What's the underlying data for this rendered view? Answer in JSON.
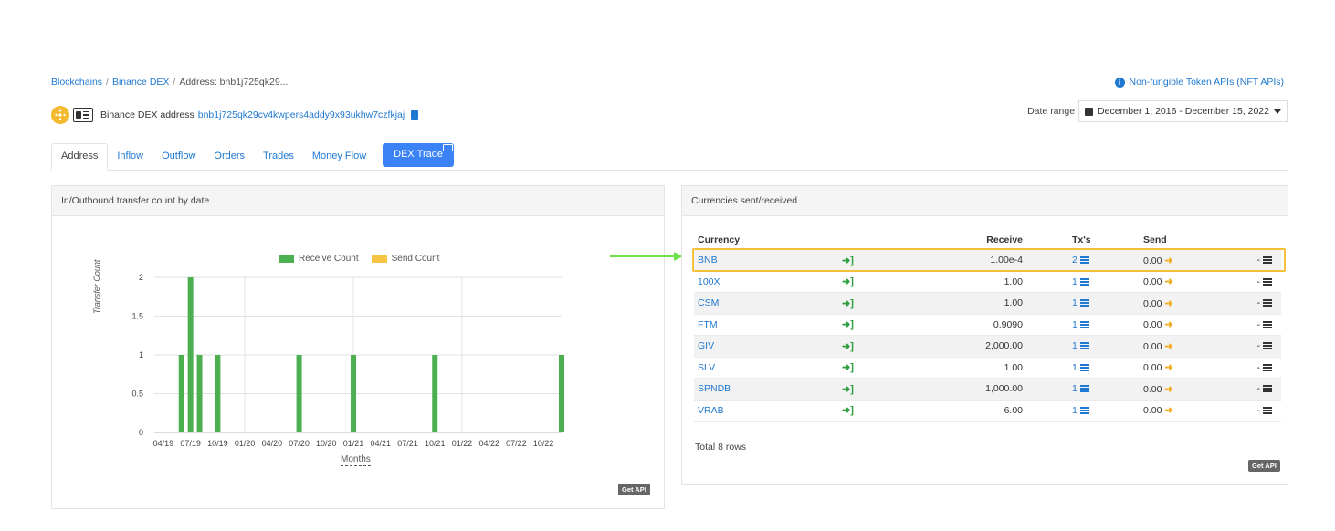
{
  "breadcrumb": {
    "item1": "Blockchains",
    "item2": "Binance DEX",
    "item3": "Address: bnb1j725qk29..."
  },
  "nft_link": "Non-fungible Token APIs (NFT APIs)",
  "address_label": "Binance DEX address",
  "address_value": "bnb1j725qk29cv4kwpers4addy9x93ukhw7czfkjaj",
  "date_range_label": "Date range",
  "date_range_value": "December 1, 2016 - December 15, 2022",
  "tabs": [
    "Address",
    "Inflow",
    "Outflow",
    "Orders",
    "Trades",
    "Money Flow",
    "DEX Trade"
  ],
  "left_panel": {
    "title": "In/Outbound transfer count by date",
    "get_api": "Get API"
  },
  "right_panel": {
    "title": "Currencies sent/received",
    "get_api": "Get API",
    "total_rows": "Total 8 rows",
    "columns": [
      "Currency",
      "",
      "Receive",
      "Tx's",
      "Send",
      ""
    ],
    "rows": [
      {
        "currency": "BNB",
        "receive": "1.00e-4",
        "txs": "2",
        "send": "0.00",
        "tail": "-"
      },
      {
        "currency": "100X",
        "receive": "1.00",
        "txs": "1",
        "send": "0.00",
        "tail": "-"
      },
      {
        "currency": "CSM",
        "receive": "1.00",
        "txs": "1",
        "send": "0.00",
        "tail": "-"
      },
      {
        "currency": "FTM",
        "receive": "0.9090",
        "txs": "1",
        "send": "0.00",
        "tail": "-"
      },
      {
        "currency": "GIV",
        "receive": "2,000.00",
        "txs": "1",
        "send": "0.00",
        "tail": "-"
      },
      {
        "currency": "SLV",
        "receive": "1.00",
        "txs": "1",
        "send": "0.00",
        "tail": "-"
      },
      {
        "currency": "SPNDB",
        "receive": "1,000.00",
        "txs": "1",
        "send": "0.00",
        "tail": "-"
      },
      {
        "currency": "VRAB",
        "receive": "6.00",
        "txs": "1",
        "send": "0.00",
        "tail": "-"
      }
    ]
  },
  "colors": {
    "link": "#1f78d1",
    "receive": "#4caf50",
    "send": "#f6c342",
    "highlight": "#f3c13a",
    "arrow": "#6ee04a",
    "dex_button": "#3b82f6"
  },
  "chart_data": {
    "type": "bar",
    "xlabel": "Months",
    "ylabel": "Transfer Count",
    "ylim": [
      0,
      2
    ],
    "yticks": [
      "0",
      "0.5",
      "1",
      "1.5",
      "2"
    ],
    "xticks": [
      "04/19",
      "07/19",
      "10/19",
      "01/20",
      "04/20",
      "07/20",
      "10/20",
      "01/21",
      "04/21",
      "07/21",
      "10/21",
      "01/22",
      "04/22",
      "07/22",
      "10/22"
    ],
    "legend": [
      "Receive Count",
      "Send Count"
    ],
    "legend_position": "top",
    "series": [
      {
        "name": "Receive Count",
        "x": [
          "2019-06",
          "2019-07",
          "2019-08",
          "2019-10",
          "2020-07",
          "2021-01",
          "2021-10",
          "2022-12"
        ],
        "values": [
          1,
          2,
          1,
          1,
          1,
          1,
          1,
          1
        ]
      },
      {
        "name": "Send Count",
        "x": [],
        "values": []
      }
    ]
  }
}
